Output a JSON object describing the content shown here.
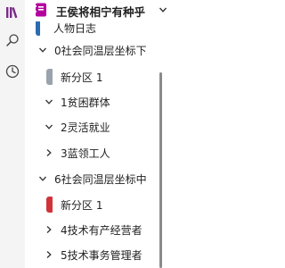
{
  "header": {
    "notebook_title": "王侯将相宁有种乎"
  },
  "tree": {
    "top_partial_label": "人物日志",
    "groups": [
      {
        "label": "0社会同温层坐标下",
        "sections": [
          {
            "label": "新分区 1",
            "tab_color": "#9aa3ad"
          },
          {
            "label": "1贫困群体"
          },
          {
            "label": "2灵活就业"
          },
          {
            "label": "3蓝领工人"
          }
        ]
      },
      {
        "label": "6社会同温层坐标中",
        "sections": [
          {
            "label": "新分区 1",
            "tab_color": "#d13438"
          },
          {
            "label": "4技术有产经营者"
          },
          {
            "label": "5技术事务管理者"
          }
        ]
      }
    ]
  },
  "colors": {
    "notebook_icon": "#b4009e",
    "rail_background": "#f4f4f4"
  },
  "icons": {
    "rail": [
      "library-icon",
      "search-icon",
      "recent-clock-icon"
    ],
    "notebook": "notebook-icon"
  }
}
